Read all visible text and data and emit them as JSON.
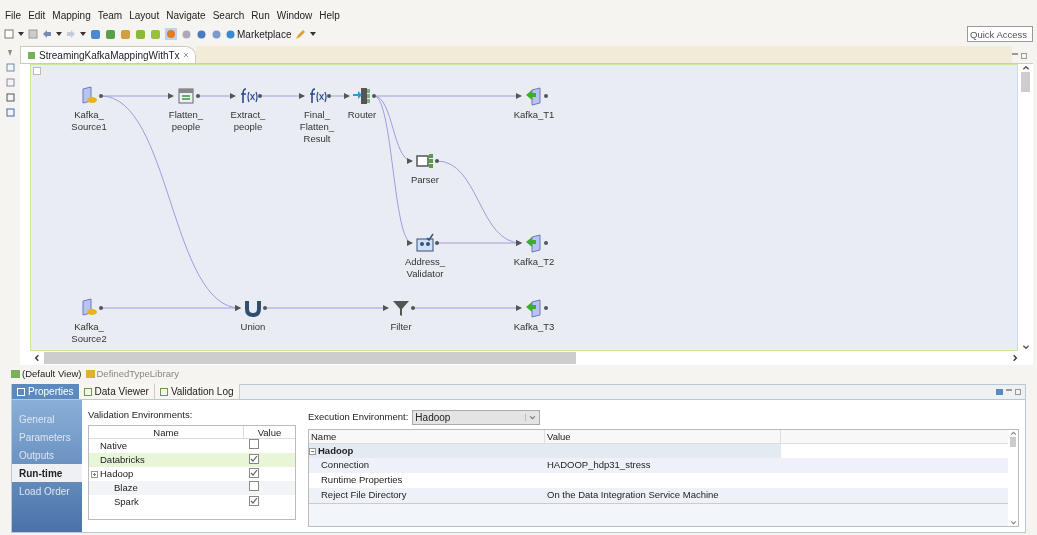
{
  "menu": [
    "File",
    "Edit",
    "Mapping",
    "Team",
    "Layout",
    "Navigate",
    "Search",
    "Run",
    "Window",
    "Help"
  ],
  "toolbar": {
    "marketplace": "Marketplace"
  },
  "quick_access": {
    "placeholder": "Quick Access"
  },
  "editor_tab": {
    "title": "StreamingKafkaMappingWithTx"
  },
  "mapping": {
    "nodes": [
      {
        "label": [
          "Kafka_",
          "Source1"
        ],
        "kind": "source"
      },
      {
        "label": [
          "Flatten_",
          "people"
        ],
        "kind": "flatten"
      },
      {
        "label": [
          "Extract_",
          "people"
        ],
        "kind": "expression"
      },
      {
        "label": [
          "Final_",
          "Flatten_",
          "Result"
        ],
        "kind": "expression"
      },
      {
        "label": [
          "Router"
        ],
        "kind": "router"
      },
      {
        "label": [
          "Kafka_T1"
        ],
        "kind": "target"
      },
      {
        "label": [
          "Parser"
        ],
        "kind": "parser"
      },
      {
        "label": [
          "Address_",
          "Validator"
        ],
        "kind": "validator"
      },
      {
        "label": [
          "Kafka_T2"
        ],
        "kind": "target"
      },
      {
        "label": [
          "Kafka_",
          "Source2"
        ],
        "kind": "source"
      },
      {
        "label": [
          "Union"
        ],
        "kind": "union"
      },
      {
        "label": [
          "Filter"
        ],
        "kind": "filter"
      },
      {
        "label": [
          "Kafka_T3"
        ],
        "kind": "target"
      }
    ]
  },
  "view_tabs": [
    {
      "label": "(Default View)",
      "selected": true
    },
    {
      "label": "DefinedTypeLibrary",
      "selected": false
    }
  ],
  "panel_tabs": [
    {
      "label": "Properties",
      "selected": true
    },
    {
      "label": "Data Viewer",
      "selected": false
    },
    {
      "label": "Validation Log",
      "selected": false
    }
  ],
  "properties_nav": [
    {
      "label": "General",
      "selected": false
    },
    {
      "label": "Parameters",
      "selected": false
    },
    {
      "label": "Outputs",
      "selected": false
    },
    {
      "label": "Run-time",
      "selected": true
    },
    {
      "label": "Load Order",
      "selected": false
    }
  ],
  "validation": {
    "title": "Validation Environments:",
    "columns": [
      "Name",
      "Value"
    ],
    "rows": [
      {
        "name": "Native",
        "checked": false,
        "selected": false
      },
      {
        "name": "Databricks",
        "checked": true,
        "selected": true
      },
      {
        "name": "Hadoop",
        "checked": true,
        "selected": false,
        "children": [
          {
            "name": "Blaze",
            "checked": false,
            "selected": false
          },
          {
            "name": "Spark",
            "checked": true,
            "selected": false
          }
        ]
      }
    ]
  },
  "execution": {
    "label": "Execution Environment:",
    "value": "Hadoop",
    "columns": [
      "Name",
      "Value"
    ],
    "groups": [
      {
        "name": "Hadoop",
        "rows": [
          {
            "name": "Connection",
            "value": "HADOOP_hdp31_stress"
          },
          {
            "name": "Runtime Properties"
          },
          {
            "name": "Reject File Directory",
            "value": "On the Data Integration Service Machine"
          }
        ]
      }
    ]
  }
}
